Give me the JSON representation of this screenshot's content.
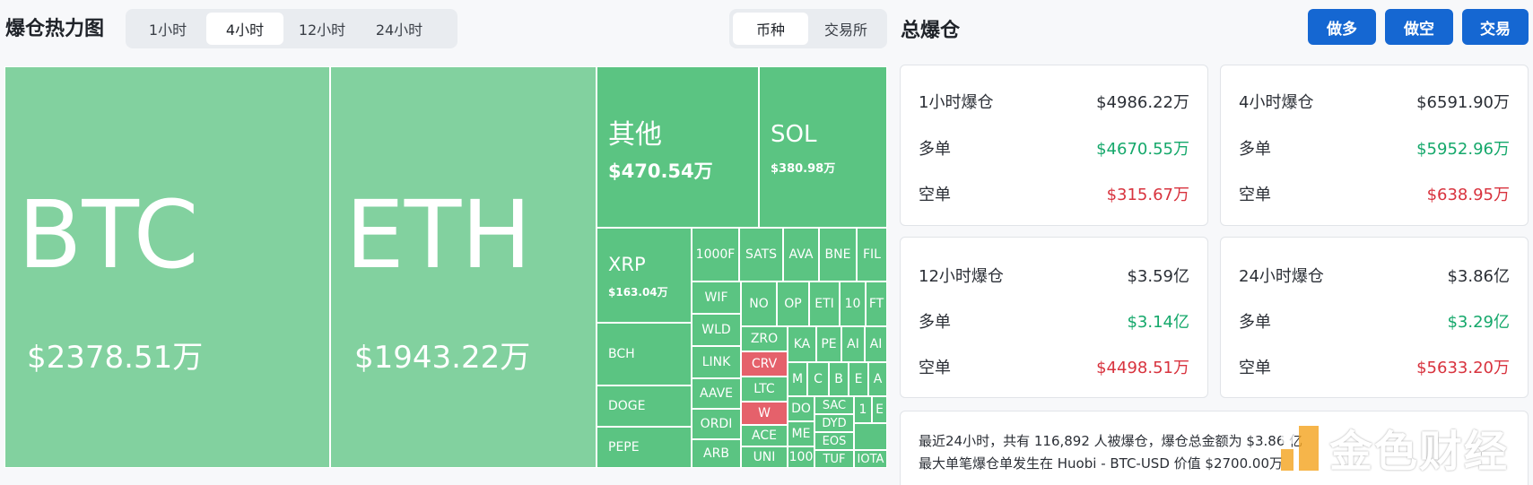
{
  "heatmap": {
    "title": "爆仓热力图",
    "time_tabs": [
      "1小时",
      "4小时",
      "12小时",
      "24小时"
    ],
    "active_time_tab": "4小时",
    "kind_tabs": [
      "币种",
      "交易所"
    ],
    "active_kind_tab": "币种",
    "big_cells": [
      {
        "symbol": "BTC",
        "amount": "$2378.51万"
      },
      {
        "symbol": "ETH",
        "amount": "$1943.22万"
      },
      {
        "symbol": "其他",
        "amount": "$470.54万"
      },
      {
        "symbol": "SOL",
        "amount": "$380.98万"
      },
      {
        "symbol": "XRP",
        "amount": "$163.04万"
      }
    ],
    "small_cells": [
      "1000F",
      "SATS",
      "AVA",
      "BNE",
      "FIL",
      "BCH",
      "DOGE",
      "PEPE",
      "WIF",
      "WLD",
      "LINK",
      "AAVE",
      "ORDI",
      "ARB",
      "NO",
      "OP",
      "ETI",
      "10",
      "FT",
      "ZRO",
      "CRV",
      "LTC",
      "W",
      "ACE",
      "UNI",
      "KA",
      "PE",
      "AI",
      "AI",
      "M",
      "C",
      "B",
      "E",
      "A",
      "DO",
      "ME",
      "100",
      "SAC",
      "DYD",
      "EOS",
      "TUF",
      "1",
      "E",
      "IOTA"
    ]
  },
  "total": {
    "title": "总爆仓",
    "buttons": [
      "做多",
      "做空",
      "交易"
    ],
    "cards": [
      {
        "title": "1小时爆仓",
        "total": "$4986.22万",
        "long_label": "多单",
        "long": "$4670.55万",
        "short_label": "空单",
        "short": "$315.67万"
      },
      {
        "title": "4小时爆仓",
        "total": "$6591.90万",
        "long_label": "多单",
        "long": "$5952.96万",
        "short_label": "空单",
        "short": "$638.95万"
      },
      {
        "title": "12小时爆仓",
        "total": "$3.59亿",
        "long_label": "多单",
        "long": "$3.14亿",
        "short_label": "空单",
        "short": "$4498.51万"
      },
      {
        "title": "24小时爆仓",
        "total": "$3.86亿",
        "long_label": "多单",
        "long": "$3.29亿",
        "short_label": "空单",
        "short": "$5633.20万"
      }
    ],
    "summary_line1": "最近24小时，共有 116,892 人被爆仓，爆仓总金额为 $3.86 亿",
    "summary_line2": "最大单笔爆仓单发生在 Huobi - BTC-USD 价值 $2700.00万"
  },
  "watermark": {
    "text": "金色财经"
  },
  "colors": {
    "long": "#15a86b",
    "short": "#d8333e",
    "accent": "#1567d2",
    "heat_green": "#5bc482",
    "heat_red": "#e5616b"
  }
}
